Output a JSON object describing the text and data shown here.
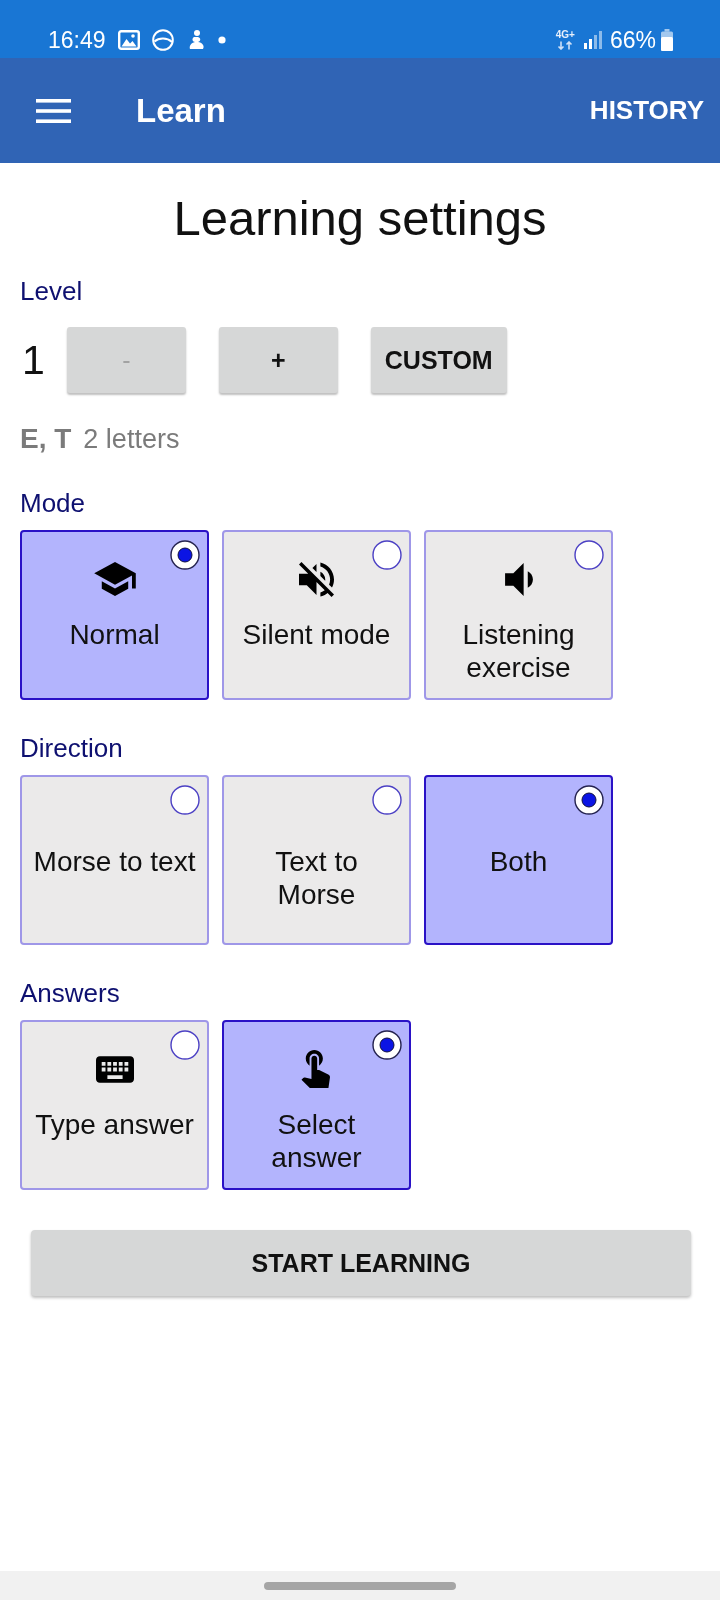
{
  "status_bar": {
    "time": "16:49",
    "network": "4G+",
    "battery": "66%"
  },
  "app_bar": {
    "title": "Learn",
    "action": "HISTORY"
  },
  "heading": "Learning settings",
  "level": {
    "label": "Level",
    "value": "1",
    "buttons": [
      {
        "label": "-",
        "kind": "step",
        "disabled": true
      },
      {
        "label": "+",
        "kind": "step",
        "disabled": false
      },
      {
        "label": "CUSTOM",
        "kind": "custom",
        "disabled": false
      }
    ],
    "letters": "E, T",
    "letter_count": "2 letters"
  },
  "sections": [
    {
      "label": "Mode",
      "options": [
        {
          "label": "Normal",
          "kind": "normal",
          "selected": true
        },
        {
          "label": "Silent mode",
          "kind": "silent",
          "selected": false
        },
        {
          "label": "Listening exercise",
          "kind": "listening",
          "selected": false
        }
      ]
    },
    {
      "label": "Direction",
      "options": [
        {
          "label": "Morse to text",
          "kind": "text",
          "selected": false
        },
        {
          "label": "Text to Morse",
          "kind": "text",
          "selected": false
        },
        {
          "label": "Both",
          "kind": "text",
          "selected": true
        }
      ]
    },
    {
      "label": "Answers",
      "options": [
        {
          "label": "Type answer",
          "kind": "typing",
          "selected": false
        },
        {
          "label": "Select answer",
          "kind": "tapping",
          "selected": true
        }
      ]
    }
  ],
  "start_button": {
    "label": "START LEARNING"
  }
}
